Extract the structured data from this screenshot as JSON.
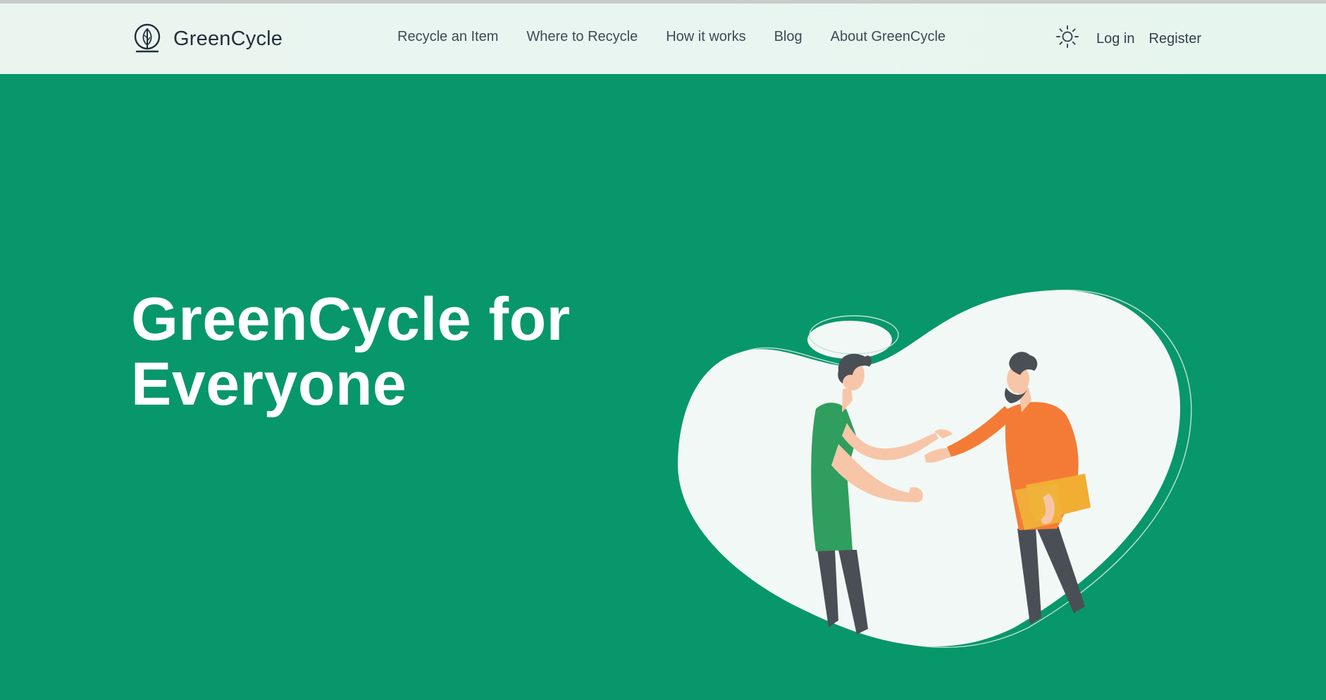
{
  "header": {
    "brand_name": "GreenCycle",
    "logo_icon": "leaf-circle-icon",
    "nav": [
      {
        "label": "Recycle an Item"
      },
      {
        "label": "Where to Recycle"
      },
      {
        "label": "How it works"
      },
      {
        "label": "Blog"
      },
      {
        "label": "About GreenCycle"
      }
    ],
    "theme_icon": "sun-icon",
    "login_label": "Log in",
    "register_label": "Register"
  },
  "hero": {
    "title": "GreenCycle for Everyone"
  },
  "colors": {
    "hero_bg": "#07976a",
    "header_bg": "#e8f5ef",
    "text_dark": "#23303a",
    "shirt_green": "#2f9e5f",
    "shirt_orange": "#f47b36",
    "folder_yellow": "#f2ad33"
  }
}
